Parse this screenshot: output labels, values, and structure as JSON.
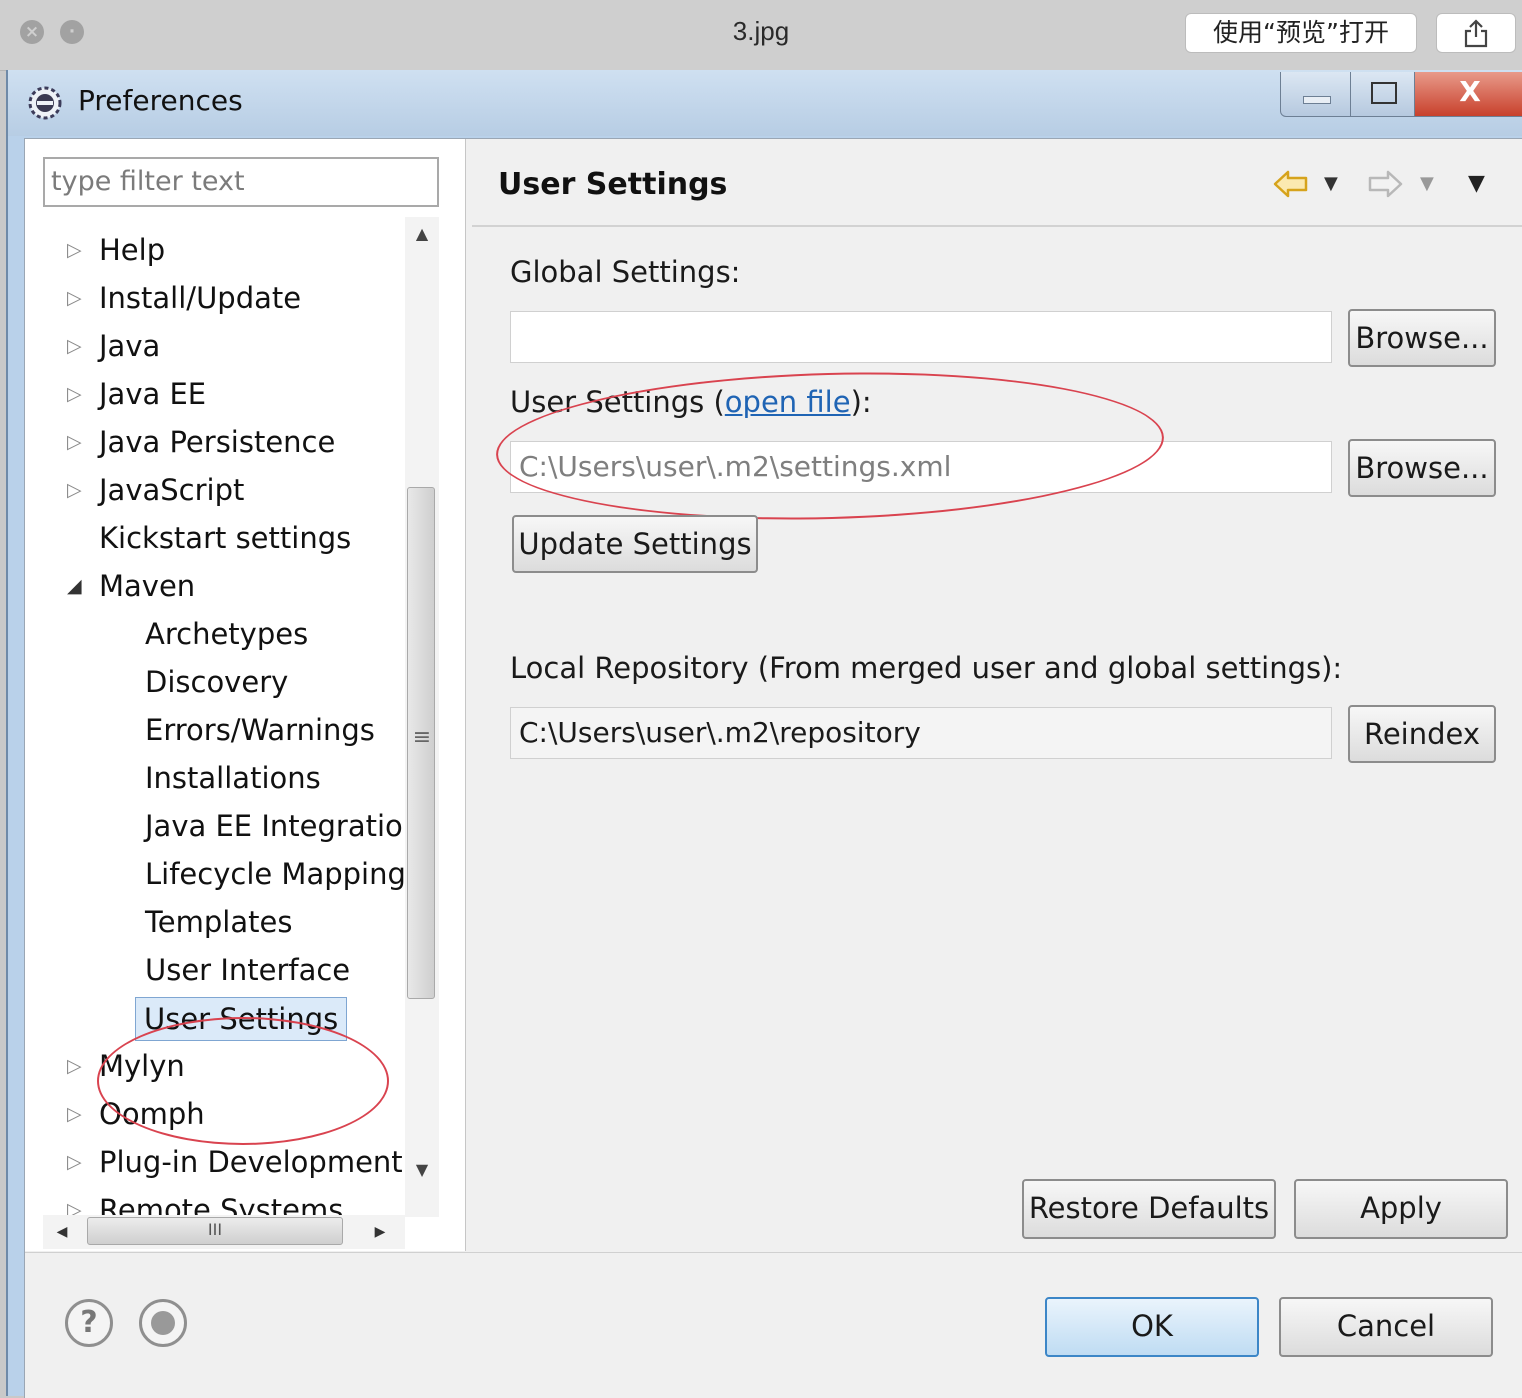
{
  "viewer": {
    "filename": "3.jpg",
    "open_with_preview": "使用“预览”打开",
    "share_icon": "share-icon"
  },
  "window": {
    "title": "Preferences",
    "close_glyph": "X"
  },
  "filter": {
    "placeholder": "type filter text"
  },
  "tree": {
    "items": [
      {
        "label": "Help",
        "expandable": true
      },
      {
        "label": "Install/Update",
        "expandable": true
      },
      {
        "label": "Java",
        "expandable": true
      },
      {
        "label": "Java EE",
        "expandable": true
      },
      {
        "label": "Java Persistence",
        "expandable": true
      },
      {
        "label": "JavaScript",
        "expandable": true
      },
      {
        "label": "Kickstart settings",
        "expandable": false
      },
      {
        "label": "Maven",
        "expanded": true
      },
      {
        "label": "Archetypes"
      },
      {
        "label": "Discovery"
      },
      {
        "label": "Errors/Warnings"
      },
      {
        "label": "Installations"
      },
      {
        "label": "Java EE Integratio"
      },
      {
        "label": "Lifecycle Mapping"
      },
      {
        "label": "Templates"
      },
      {
        "label": "User Interface"
      },
      {
        "label": "User Settings",
        "selected": true
      },
      {
        "label": "Mylyn",
        "expandable": true
      },
      {
        "label": "Oomph",
        "expandable": true
      },
      {
        "label": "Plug-in Development",
        "expandable": true
      },
      {
        "label": "Remote Systems",
        "expandable": true
      }
    ],
    "scroll_grip": "≡",
    "hscroll_grip": "III"
  },
  "page": {
    "title": "User Settings",
    "global_settings_label": "Global Settings:",
    "global_settings_value": "",
    "user_settings_label_pre": "User Settings (",
    "user_settings_link": "open file",
    "user_settings_label_post": "):",
    "user_settings_value": "C:\\Users\\user\\.m2\\settings.xml",
    "browse_label": "Browse...",
    "update_settings_label": "Update Settings",
    "local_repo_label": "Local Repository (From merged user and global settings):",
    "local_repo_value": "C:\\Users\\user\\.m2\\repository",
    "reindex_label": "Reindex",
    "restore_defaults_label": "Restore Defaults",
    "apply_label": "Apply"
  },
  "buttons": {
    "ok": "OK",
    "cancel": "Cancel",
    "help_glyph": "?"
  },
  "colors": {
    "annotation": "#d9434f",
    "link": "#1f64b4",
    "selection": "#dbeaf9"
  }
}
